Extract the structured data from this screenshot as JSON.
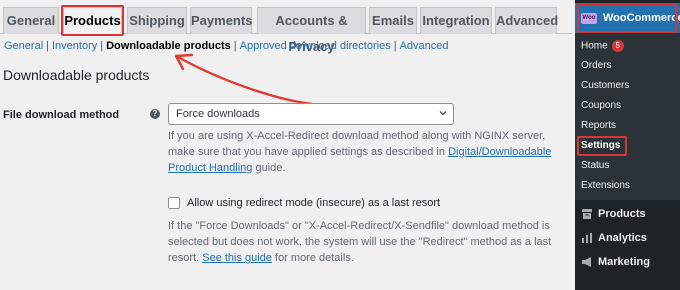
{
  "tabs": [
    {
      "label": "General"
    },
    {
      "label": "Products"
    },
    {
      "label": "Shipping"
    },
    {
      "label": "Payments"
    },
    {
      "label": "Accounts & Privacy"
    },
    {
      "label": "Emails"
    },
    {
      "label": "Integration"
    },
    {
      "label": "Advanced"
    }
  ],
  "subnav": {
    "general": "General",
    "inventory": "Inventory",
    "downloadable": "Downloadable products",
    "approved": "Approved download directories",
    "advanced": "Advanced",
    "sep": "|"
  },
  "section_title": "Downloadable products",
  "download_method": {
    "label": "File download method",
    "help_icon": "?",
    "value": "Force downloads",
    "desc_part1": "If you are using X-Accel-Redirect download method along with NGINX server, make sure that you have applied settings as described in ",
    "desc_link": "Digital/Downloadable Product Handling",
    "desc_part2": " guide."
  },
  "redirect_option": {
    "label": "Allow using redirect mode (insecure) as a last resort",
    "checked": false,
    "desc_part1": "If the \"Force Downloads\" or \"X-Accel-Redirect/X-Sendfile\" download method is selected but does not work, the system will use the \"Redirect\" method as a last resort. ",
    "desc_link": "See this guide",
    "desc_part2": " for more details."
  },
  "sidebar": {
    "title": "WooCommerce",
    "logo_text": "Woo",
    "items": [
      {
        "label": "Home",
        "badge": "5"
      },
      {
        "label": "Orders"
      },
      {
        "label": "Customers"
      },
      {
        "label": "Coupons"
      },
      {
        "label": "Reports"
      },
      {
        "label": "Settings"
      },
      {
        "label": "Status"
      },
      {
        "label": "Extensions"
      }
    ],
    "menu": [
      {
        "label": "Products",
        "icon": "archive-icon"
      },
      {
        "label": "Analytics",
        "icon": "bar-chart-icon"
      },
      {
        "label": "Marketing",
        "icon": "megaphone-icon"
      }
    ]
  },
  "colors": {
    "accent": "#2271b1",
    "highlight": "#d63638",
    "sidebar_bg": "#1d2327"
  }
}
